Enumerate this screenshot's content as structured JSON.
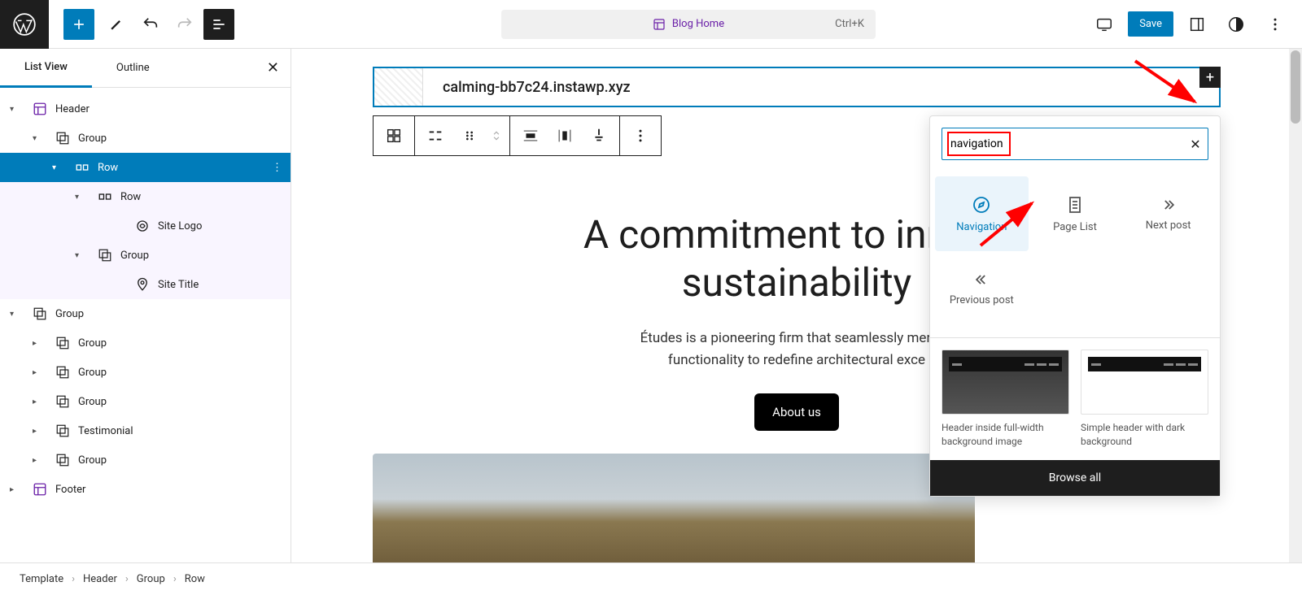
{
  "toolbar": {
    "center_title": "Blog Home",
    "shortcut": "Ctrl+K",
    "save_label": "Save"
  },
  "tabs": {
    "list_view": "List View",
    "outline": "Outline"
  },
  "tree": [
    {
      "label": "Header",
      "icon": "layout",
      "chev": "down",
      "indent": 0,
      "purple": true
    },
    {
      "label": "Group",
      "icon": "group",
      "chev": "down",
      "indent": 1
    },
    {
      "label": "Row",
      "icon": "row",
      "chev": "down",
      "indent": 2,
      "selected": true,
      "more": true
    },
    {
      "label": "Row",
      "icon": "row",
      "chev": "down",
      "indent": 3,
      "tinted": true
    },
    {
      "label": "Site Logo",
      "icon": "logo",
      "chev": "",
      "indent": 4,
      "tinted": true
    },
    {
      "label": "Group",
      "icon": "group",
      "chev": "down",
      "indent": 3,
      "tinted": true
    },
    {
      "label": "Site Title",
      "icon": "pin",
      "chev": "",
      "indent": 4,
      "tinted": true
    },
    {
      "label": "Group",
      "icon": "group",
      "chev": "down",
      "indent": 0
    },
    {
      "label": "Group",
      "icon": "group",
      "chev": "right",
      "indent": 1
    },
    {
      "label": "Group",
      "icon": "group",
      "chev": "right",
      "indent": 1
    },
    {
      "label": "Group",
      "icon": "group",
      "chev": "right",
      "indent": 1
    },
    {
      "label": "Testimonial",
      "icon": "group",
      "chev": "right",
      "indent": 1
    },
    {
      "label": "Group",
      "icon": "group",
      "chev": "right",
      "indent": 1
    },
    {
      "label": "Footer",
      "icon": "layout",
      "chev": "right",
      "indent": 0,
      "purple": true
    }
  ],
  "header_block": {
    "url": "calming-bb7c24.instawp.xyz"
  },
  "hero": {
    "title_line1": "A commitment to innova",
    "title_line2": "sustainability",
    "para_line1": "Études is a pioneering firm that seamlessly merges",
    "para_line2": "functionality to redefine architectural exce",
    "button": "About us"
  },
  "inserter": {
    "search_value": "navigation",
    "results": [
      {
        "label": "Navigation",
        "icon": "compass",
        "active": true
      },
      {
        "label": "Page List",
        "icon": "pagelist"
      },
      {
        "label": "Next post",
        "icon": "next"
      },
      {
        "label": "Previous post",
        "icon": "prev"
      }
    ],
    "patterns": [
      {
        "label": "Header inside full-width background image",
        "kind": "dark"
      },
      {
        "label": "Simple header with dark background",
        "kind": "light"
      }
    ],
    "browse": "Browse all"
  },
  "breadcrumb": [
    "Template",
    "Header",
    "Group",
    "Row"
  ]
}
